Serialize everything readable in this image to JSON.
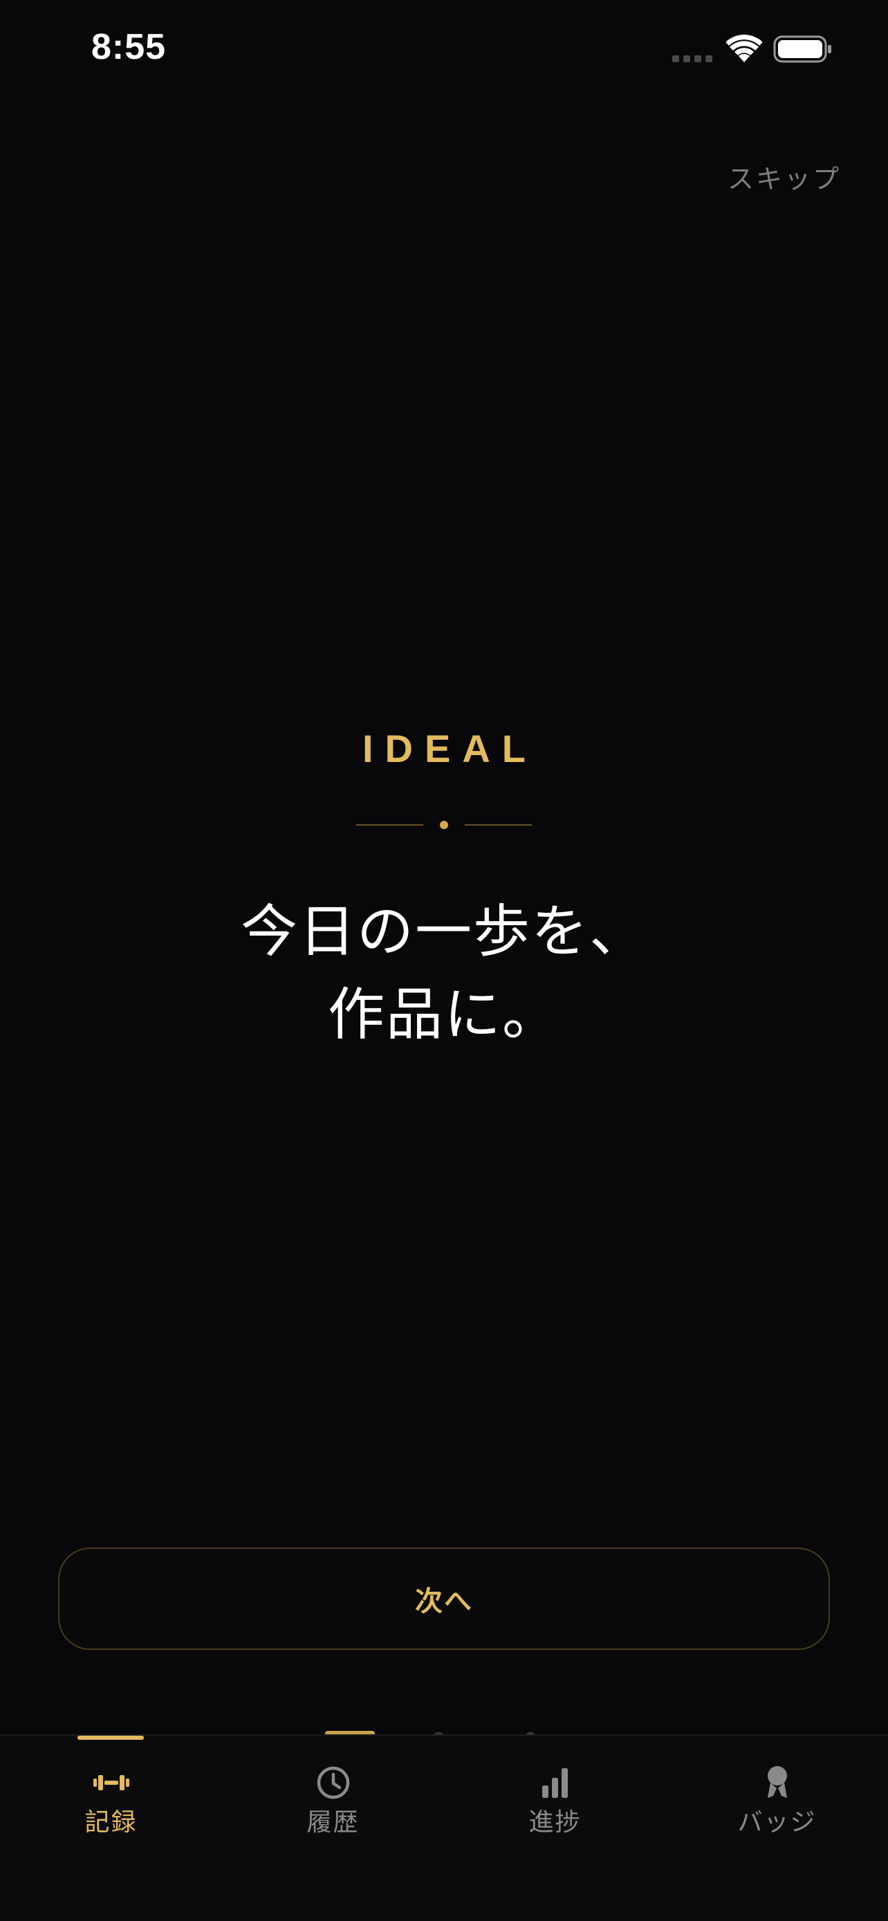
{
  "status_bar": {
    "time": "8:55"
  },
  "onboarding": {
    "skip_label": "スキップ",
    "brand": "IDEAL",
    "tagline_line1": "今日の一歩を、",
    "tagline_line2": "作品に。",
    "next_label": "次へ",
    "page_count": 4,
    "current_page": 1
  },
  "tab_bar": {
    "items": [
      {
        "label": "記録",
        "icon": "dumbbell-icon",
        "active": true
      },
      {
        "label": "履歴",
        "icon": "clock-icon",
        "active": false
      },
      {
        "label": "進捗",
        "icon": "bar-chart-icon",
        "active": false
      },
      {
        "label": "バッジ",
        "icon": "medal-icon",
        "active": false
      }
    ]
  },
  "colors": {
    "background": "#08080a",
    "accent_gold": "#e3bb5e",
    "inactive_gray": "#8a8a8c"
  }
}
